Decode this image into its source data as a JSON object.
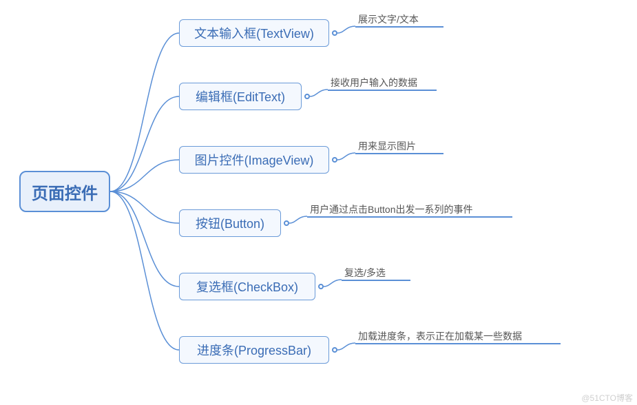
{
  "root": {
    "label": "页面控件"
  },
  "children": [
    {
      "label": "文本输入框(TextView)",
      "leaf": "展示文字/文本"
    },
    {
      "label": "编辑框(EditText)",
      "leaf": "接收用户输入的数据"
    },
    {
      "label": "图片控件(ImageView)",
      "leaf": "用来显示图片"
    },
    {
      "label": "按钮(Button)",
      "leaf": "用户通过点击Button出发一系列的事件"
    },
    {
      "label": "复选框(CheckBox)",
      "leaf": "复选/多选"
    },
    {
      "label": "进度条(ProgressBar)",
      "leaf": "加载进度条，表示正在加载某一些数据"
    }
  ],
  "watermark": "@51CTO博客",
  "layout": {
    "rootRight": 160,
    "rootCenterY": 278,
    "childLeft": 260,
    "childHeight": 40,
    "childYs": [
      28,
      120,
      212,
      304,
      396,
      488
    ],
    "childWidths": [
      218,
      178,
      218,
      148,
      198,
      218
    ],
    "leafGap": 26,
    "underlineApprox": [
      128,
      158,
      128,
      298,
      100,
      298
    ]
  }
}
